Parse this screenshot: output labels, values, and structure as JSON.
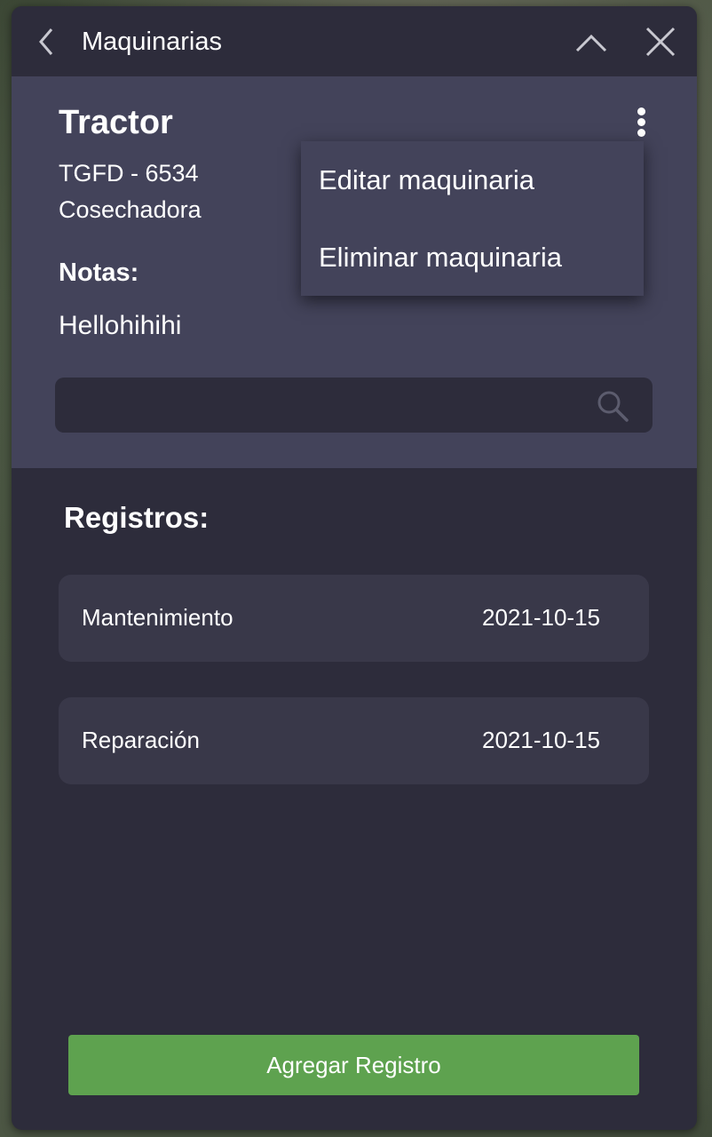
{
  "header": {
    "title": "Maquinarias"
  },
  "machine": {
    "name": "Tractor",
    "plate": "TGFD - 6534",
    "type": "Cosechadora",
    "notes_label": "Notas:",
    "notes": "Hellohihihi"
  },
  "menu": {
    "items": [
      "Editar maquinaria",
      "Eliminar maquinaria"
    ]
  },
  "search": {
    "value": "",
    "placeholder": ""
  },
  "records": {
    "title": "Registros:",
    "items": [
      {
        "type": "Mantenimiento",
        "date": "2021-10-15"
      },
      {
        "type": "Reparación",
        "date": "2021-10-15"
      }
    ]
  },
  "actions": {
    "add_label": "Agregar Registro"
  },
  "colors": {
    "panel": "#2d2c3b",
    "info": "#43435a",
    "record": "#393849",
    "accent": "#5ea24f"
  },
  "icons": [
    "chevron-left-icon",
    "chevron-up-icon",
    "close-icon",
    "more-vertical-icon",
    "search-icon"
  ]
}
